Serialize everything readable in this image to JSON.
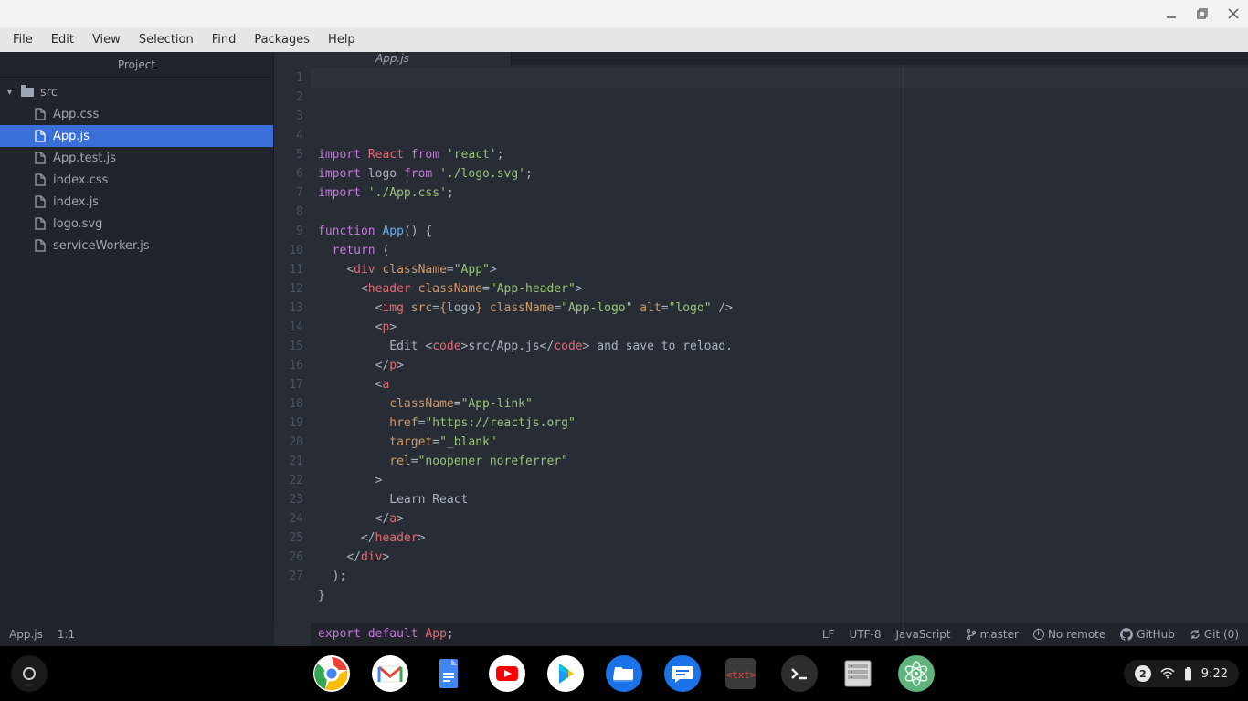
{
  "menubar": {
    "items": [
      "File",
      "Edit",
      "View",
      "Selection",
      "Find",
      "Packages",
      "Help"
    ]
  },
  "sidebar": {
    "title": "Project",
    "root": {
      "name": "src",
      "expanded": true
    },
    "files": [
      "App.css",
      "App.js",
      "App.test.js",
      "index.css",
      "index.js",
      "logo.svg",
      "serviceWorker.js"
    ],
    "selected": "App.js"
  },
  "editor": {
    "tab_title": "App.js",
    "line_count": 27,
    "lines": [
      [
        [
          "kw",
          "import"
        ],
        [
          "",
          " "
        ],
        [
          "id",
          "React"
        ],
        [
          "",
          " "
        ],
        [
          "kw",
          "from"
        ],
        [
          "",
          " "
        ],
        [
          "str",
          "'react'"
        ],
        [
          "",
          ";"
        ]
      ],
      [
        [
          "kw",
          "import"
        ],
        [
          "",
          " "
        ],
        [
          "",
          "logo"
        ],
        [
          "",
          " "
        ],
        [
          "kw",
          "from"
        ],
        [
          "",
          " "
        ],
        [
          "str",
          "'./logo.svg'"
        ],
        [
          "",
          ";"
        ]
      ],
      [
        [
          "kw",
          "import"
        ],
        [
          "",
          " "
        ],
        [
          "str",
          "'./App.css'"
        ],
        [
          "",
          ";"
        ]
      ],
      [
        [
          "",
          ""
        ]
      ],
      [
        [
          "kw",
          "function"
        ],
        [
          "",
          " "
        ],
        [
          "fn",
          "App"
        ],
        [
          "",
          "() {"
        ]
      ],
      [
        [
          "",
          "  "
        ],
        [
          "kw",
          "return"
        ],
        [
          "",
          " ("
        ]
      ],
      [
        [
          "",
          "    "
        ],
        [
          "angle",
          "<"
        ],
        [
          "tag",
          "div"
        ],
        [
          "",
          " "
        ],
        [
          "attr",
          "className"
        ],
        [
          "",
          "="
        ],
        [
          "str",
          "\"App\""
        ],
        [
          "angle",
          ">"
        ]
      ],
      [
        [
          "",
          "      "
        ],
        [
          "angle",
          "<"
        ],
        [
          "tag",
          "header"
        ],
        [
          "",
          " "
        ],
        [
          "attr",
          "className"
        ],
        [
          "",
          "="
        ],
        [
          "str",
          "\"App-header\""
        ],
        [
          "angle",
          ">"
        ]
      ],
      [
        [
          "",
          "        "
        ],
        [
          "angle",
          "<"
        ],
        [
          "tag",
          "img"
        ],
        [
          "",
          " "
        ],
        [
          "attr",
          "src"
        ],
        [
          "",
          "="
        ],
        [
          "brace",
          "{"
        ],
        [
          "",
          "logo"
        ],
        [
          "brace",
          "}"
        ],
        [
          "",
          " "
        ],
        [
          "attr",
          "className"
        ],
        [
          "",
          "="
        ],
        [
          "str",
          "\"App-logo\""
        ],
        [
          "",
          " "
        ],
        [
          "attr",
          "alt"
        ],
        [
          "",
          "="
        ],
        [
          "str",
          "\"logo\""
        ],
        [
          "",
          " "
        ],
        [
          "angle",
          "/>"
        ]
      ],
      [
        [
          "",
          "        "
        ],
        [
          "angle",
          "<"
        ],
        [
          "tag",
          "p"
        ],
        [
          "angle",
          ">"
        ]
      ],
      [
        [
          "",
          "          Edit "
        ],
        [
          "angle",
          "<"
        ],
        [
          "tag",
          "code"
        ],
        [
          "angle",
          ">"
        ],
        [
          "",
          "src/App.js"
        ],
        [
          "angle",
          "</"
        ],
        [
          "tag",
          "code"
        ],
        [
          "angle",
          ">"
        ],
        [
          "",
          " and save to reload."
        ]
      ],
      [
        [
          "",
          "        "
        ],
        [
          "angle",
          "</"
        ],
        [
          "tag",
          "p"
        ],
        [
          "angle",
          ">"
        ]
      ],
      [
        [
          "",
          "        "
        ],
        [
          "angle",
          "<"
        ],
        [
          "tag",
          "a"
        ]
      ],
      [
        [
          "",
          "          "
        ],
        [
          "attr",
          "className"
        ],
        [
          "",
          "="
        ],
        [
          "str",
          "\"App-link\""
        ]
      ],
      [
        [
          "",
          "          "
        ],
        [
          "attr",
          "href"
        ],
        [
          "",
          "="
        ],
        [
          "str",
          "\"https://reactjs.org\""
        ]
      ],
      [
        [
          "",
          "          "
        ],
        [
          "attr",
          "target"
        ],
        [
          "",
          "="
        ],
        [
          "str",
          "\"_blank\""
        ]
      ],
      [
        [
          "",
          "          "
        ],
        [
          "attr",
          "rel"
        ],
        [
          "",
          "="
        ],
        [
          "str",
          "\"noopener noreferrer\""
        ]
      ],
      [
        [
          "",
          "        "
        ],
        [
          "angle",
          ">"
        ]
      ],
      [
        [
          "",
          "          Learn React"
        ]
      ],
      [
        [
          "",
          "        "
        ],
        [
          "angle",
          "</"
        ],
        [
          "tag",
          "a"
        ],
        [
          "angle",
          ">"
        ]
      ],
      [
        [
          "",
          "      "
        ],
        [
          "angle",
          "</"
        ],
        [
          "tag",
          "header"
        ],
        [
          "angle",
          ">"
        ]
      ],
      [
        [
          "",
          "    "
        ],
        [
          "angle",
          "</"
        ],
        [
          "tag",
          "div"
        ],
        [
          "angle",
          ">"
        ]
      ],
      [
        [
          "",
          "  );"
        ]
      ],
      [
        [
          "",
          "}"
        ]
      ],
      [
        [
          "",
          ""
        ]
      ],
      [
        [
          "kw",
          "export"
        ],
        [
          "",
          " "
        ],
        [
          "kw",
          "default"
        ],
        [
          "",
          " "
        ],
        [
          "id",
          "App"
        ],
        [
          "",
          ";"
        ]
      ],
      [
        [
          "",
          ""
        ]
      ]
    ]
  },
  "statusbar": {
    "filename": "App.js",
    "cursor": "1:1",
    "eol": "LF",
    "encoding": "UTF-8",
    "language": "JavaScript",
    "branch": "master",
    "remote": "No remote",
    "github": "GitHub",
    "git": "Git (0)"
  },
  "shelf": {
    "apps": [
      {
        "name": "chrome",
        "bg": "#fff"
      },
      {
        "name": "gmail",
        "bg": "#fff"
      },
      {
        "name": "docs",
        "bg": "#4285f4"
      },
      {
        "name": "youtube",
        "bg": "#fff"
      },
      {
        "name": "play",
        "bg": "#fff"
      },
      {
        "name": "files",
        "bg": "#1a73e8"
      },
      {
        "name": "messages",
        "bg": "#1a73e8"
      },
      {
        "name": "text",
        "bg": "#2d2d2d"
      },
      {
        "name": "terminal",
        "bg": "#2d2d2d"
      },
      {
        "name": "file-manager",
        "bg": "#d8d8d8"
      },
      {
        "name": "atom",
        "bg": "#5fb57d"
      }
    ]
  },
  "tray": {
    "notifications": "2",
    "time": "9:22"
  }
}
